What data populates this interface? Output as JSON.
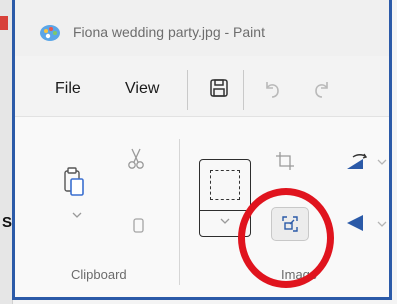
{
  "window": {
    "title": "Fiona wedding party.jpg - Paint"
  },
  "menu": {
    "file": "File",
    "view": "View"
  },
  "toolbar": {
    "save_icon": "save-icon",
    "undo_icon": "undo-icon",
    "redo_icon": "redo-icon"
  },
  "ribbon": {
    "groups": [
      {
        "label": "Clipboard",
        "icons": [
          "paste-icon",
          "cut-icon",
          "copy-icon"
        ]
      },
      {
        "label": "Image",
        "icons": [
          "select-icon",
          "crop-icon",
          "resize-icon",
          "rotate-icon",
          "flip-icon"
        ]
      }
    ]
  },
  "colors": {
    "frame_border": "#2b5aa8",
    "highlight": "#e0141e"
  }
}
